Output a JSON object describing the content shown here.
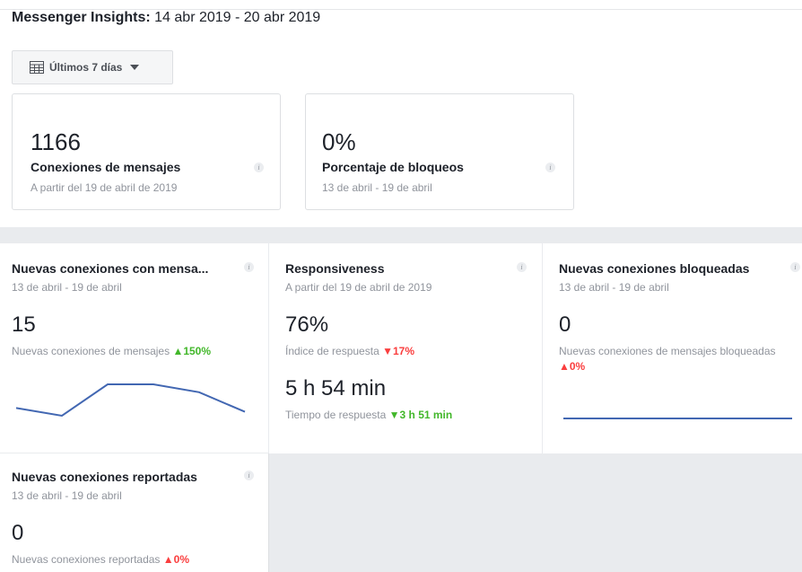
{
  "header": {
    "title_bold": "Messenger Insights:",
    "title_range": "14 abr 2019 - 20 abr 2019"
  },
  "range_selector": {
    "label": "Últimos 7 días",
    "icon": "calendar-icon"
  },
  "summary_cards": [
    {
      "value": "1166",
      "label": "Conexiones de mensajes",
      "sub": "A partir del 19 de abril de 2019"
    },
    {
      "value": "0%",
      "label": "Porcentaje de bloqueos",
      "sub": "13 de abril - 19 de abril"
    }
  ],
  "panels": {
    "new_connections": {
      "title": "Nuevas conexiones con mensa...",
      "period": "13 de abril - 19 de abril",
      "value": "15",
      "metric_label": "Nuevas conexiones de mensajes",
      "delta": "▲150%",
      "sparkline": [
        5,
        4,
        8,
        8,
        7,
        4.5
      ]
    },
    "responsiveness": {
      "title": "Responsiveness",
      "period": "A partir del 19 de abril de 2019",
      "value": "76%",
      "metric_label": "Índice de respuesta",
      "delta": "▼17%",
      "time_value": "5 h 54 min",
      "time_label": "Tiempo de respuesta",
      "time_delta": "▼3 h 51 min"
    },
    "blocked": {
      "title": "Nuevas conexiones bloqueadas",
      "period": "13 de abril - 19 de abril",
      "value": "0",
      "metric_label": "Nuevas conexiones de mensajes bloqueadas",
      "delta": "▲0%",
      "sparkline": [
        0,
        0,
        0,
        0,
        0,
        0
      ]
    },
    "reported": {
      "title": "Nuevas conexiones reportadas",
      "period": "13 de abril - 19 de abril",
      "value": "0",
      "metric_label": "Nuevas conexiones reportadas",
      "delta": "▲0%"
    }
  },
  "colors": {
    "accent": "#4267b2",
    "up": "#42b72a",
    "down": "#fa3e3e",
    "muted": "#90949c",
    "background_grey": "#e9ebee"
  }
}
